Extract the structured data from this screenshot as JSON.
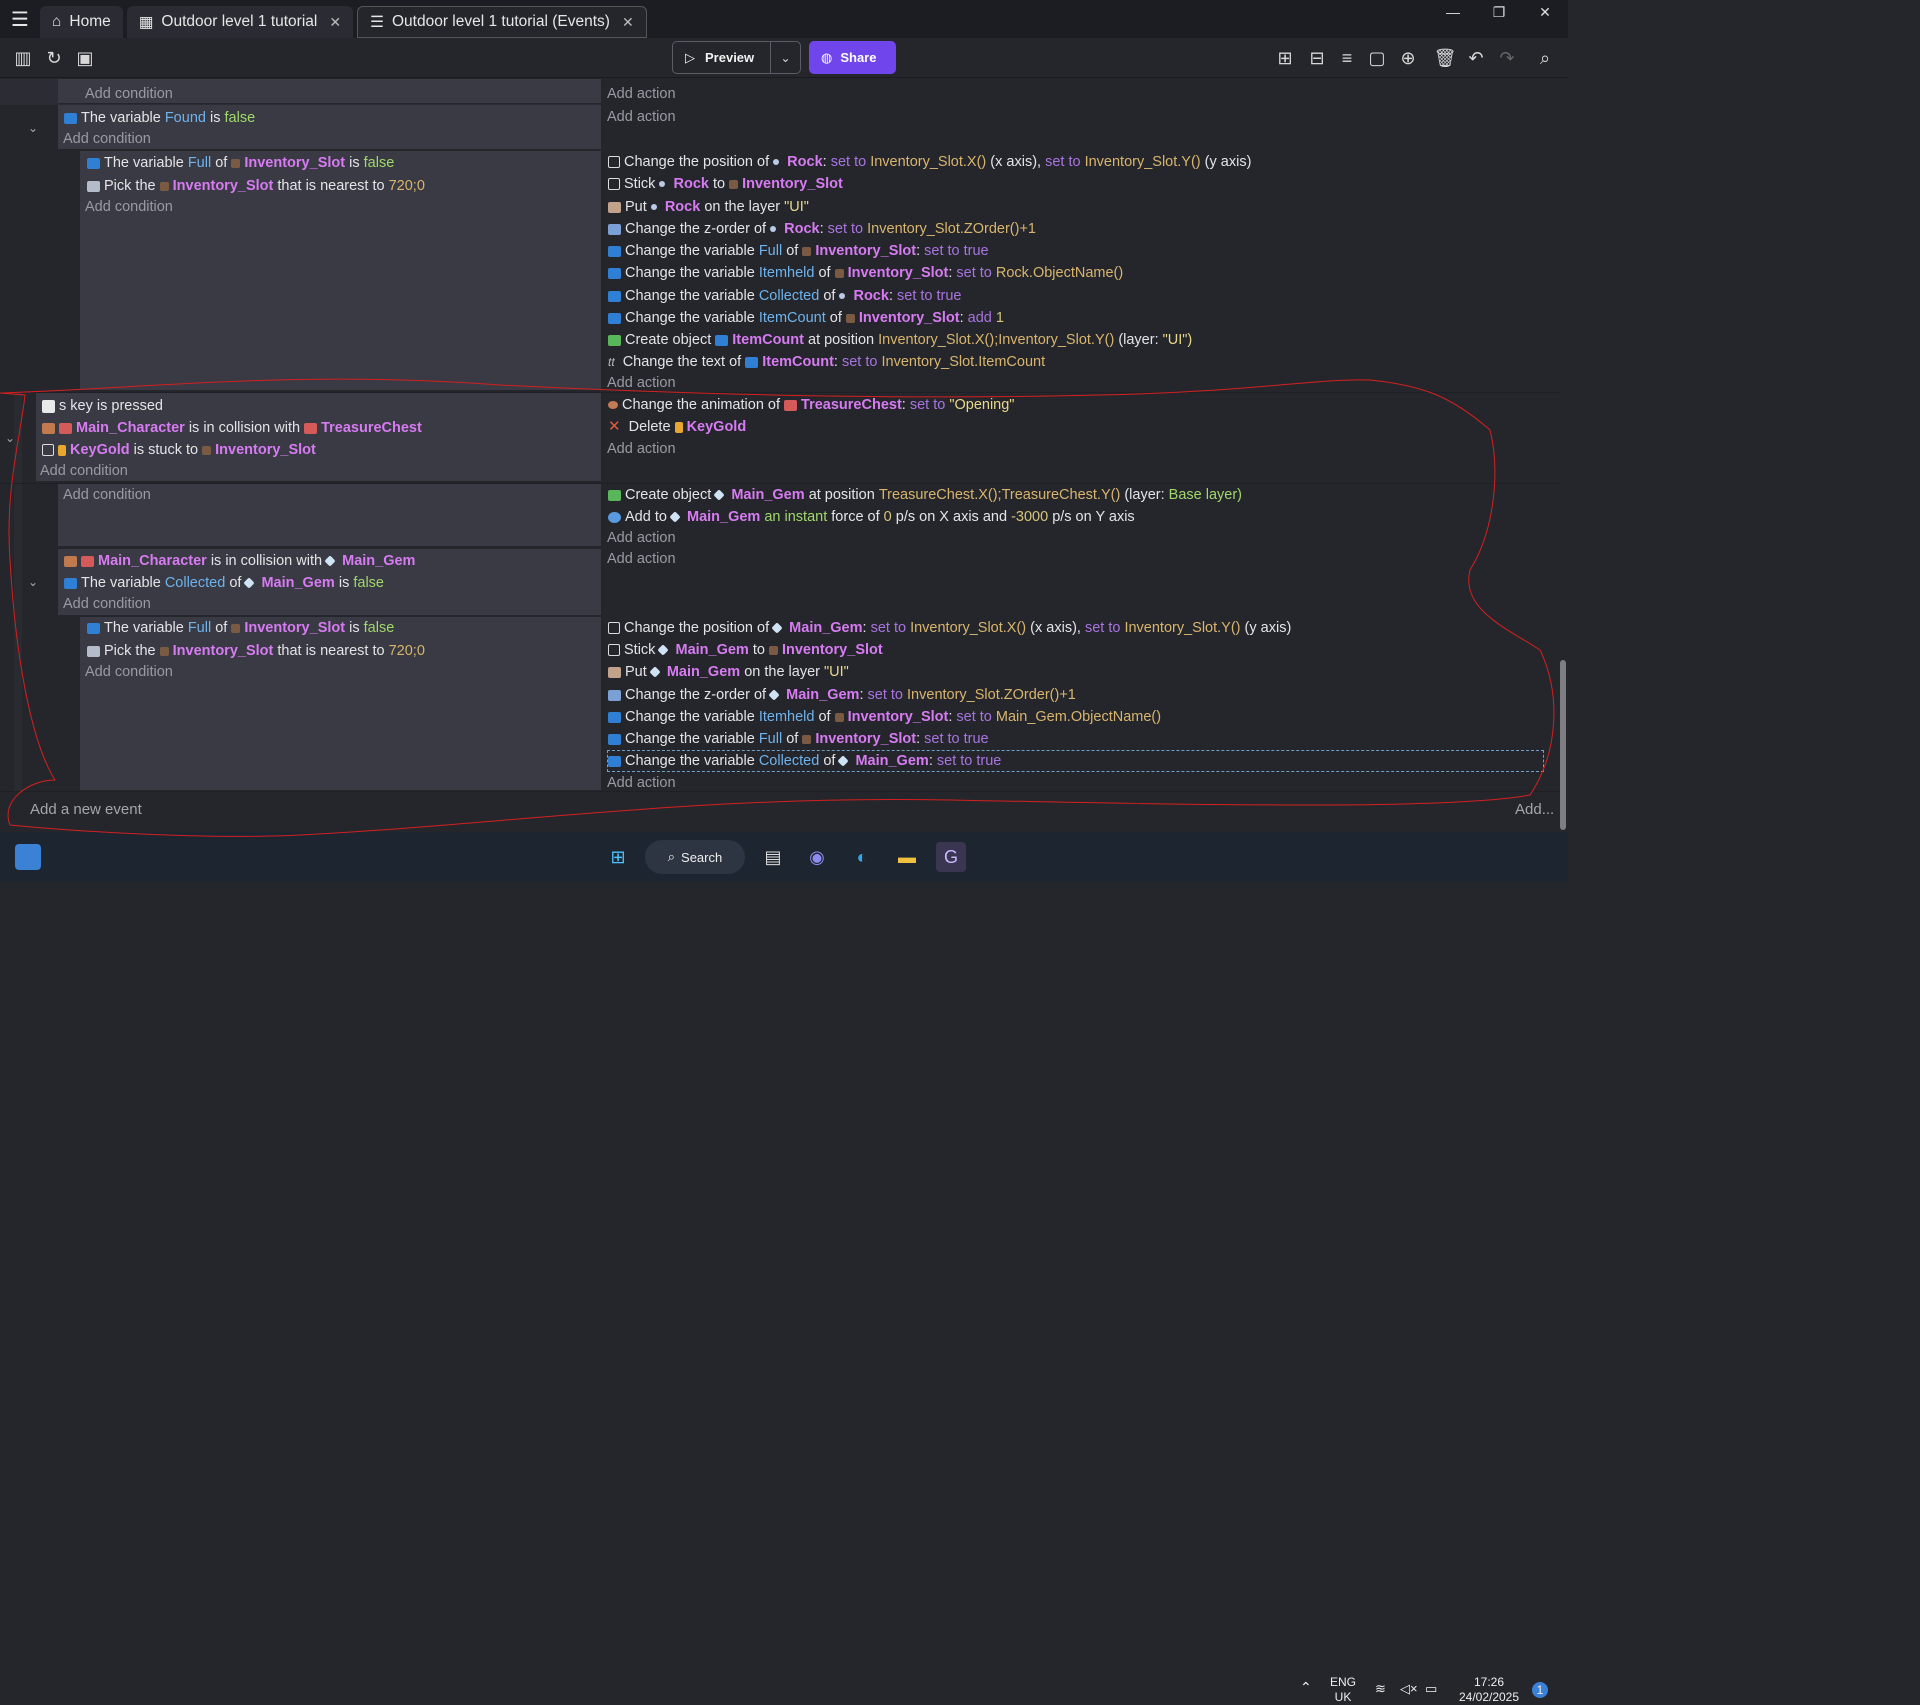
{
  "tabs": [
    {
      "label": "Home",
      "icon": "home-icon"
    },
    {
      "label": "Outdoor level 1 tutorial",
      "icon": "scene-icon"
    },
    {
      "label": "Outdoor level 1 tutorial (Events)",
      "icon": "events-icon"
    }
  ],
  "toolbar": {
    "preview": "Preview",
    "share": "Share"
  },
  "add_condition": "Add condition",
  "add_action": "Add action",
  "add_event": "Add a new event",
  "add_more": "Add...",
  "ev1": {
    "c1a": "The variable",
    "c1b": "Found",
    "c1c": "is",
    "c1d": "false"
  },
  "ev2": {
    "c1a": "The variable",
    "c1b": "Full",
    "c1c": "of",
    "c1d": "Inventory_Slot",
    "c1e": "is",
    "c1f": "false",
    "c2a": "Pick the",
    "c2b": "Inventory_Slot",
    "c2c": "that is nearest to",
    "c2d": "720;0",
    "a1": "Change the position of",
    "a1b": "Rock",
    "a1c": "set to",
    "a1d": "Inventory_Slot.X()",
    "a1e": "(x axis),",
    "a1f": "set to",
    "a1g": "Inventory_Slot.Y()",
    "a1h": "(y axis)",
    "a2": "Stick",
    "a2b": "Rock",
    "a2c": "to",
    "a2d": "Inventory_Slot",
    "a3": "Put",
    "a3b": "Rock",
    "a3c": "on the layer",
    "a3d": "\"UI\"",
    "a4": "Change the z-order of",
    "a4b": "Rock",
    "a4c": "set to",
    "a4d": "Inventory_Slot.ZOrder()+1",
    "a5": "Change the variable",
    "a5b": "Full",
    "a5c": "of",
    "a5d": "Inventory_Slot",
    "a5e": "set to true",
    "a6": "Change the variable",
    "a6b": "Itemheld",
    "a6c": "of",
    "a6d": "Inventory_Slot",
    "a6e": "set to",
    "a6f": "Rock.ObjectName()",
    "a7": "Change the variable",
    "a7b": "Collected",
    "a7c": "of",
    "a7d": "Rock",
    "a7e": "set to true",
    "a8": "Change the variable",
    "a8b": "ItemCount",
    "a8c": "of",
    "a8d": "Inventory_Slot",
    "a8e": "add",
    "a8f": "1",
    "a9": "Create object",
    "a9b": "ItemCount",
    "a9c": "at position",
    "a9d": "Inventory_Slot.X();Inventory_Slot.Y()",
    "a9e": "(layer:",
    "a9f": "\"UI\")",
    "a10": "Change the text of",
    "a10b": "ItemCount",
    "a10c": "set to",
    "a10d": "Inventory_Slot.ItemCount"
  },
  "ev3": {
    "c1a": "s",
    "c1b": "key is pressed",
    "c2a": "Main_Character",
    "c2b": "is in collision with",
    "c2c": "TreasureChest",
    "c3a": "KeyGold",
    "c3b": "is stuck to",
    "c3c": "Inventory_Slot",
    "a1": "Change the animation of",
    "a1b": "TreasureChest",
    "a1c": "set to",
    "a1d": "\"Opening\"",
    "a2": "Delete",
    "a2b": "KeyGold"
  },
  "ev4": {
    "a1": "Create object",
    "a1b": "Main_Gem",
    "a1c": "at position",
    "a1d": "TreasureChest.X();TreasureChest.Y()",
    "a1e": "(layer:",
    "a1f": "Base layer)",
    "a2": "Add to",
    "a2b": "Main_Gem",
    "a2c": "an instant",
    "a2d": "force of",
    "a2e": "0",
    "a2f": "p/s on X axis and",
    "a2g": "-3000",
    "a2h": "p/s on Y axis"
  },
  "ev5": {
    "c1a": "Main_Character",
    "c1b": "is in collision with",
    "c1c": "Main_Gem",
    "c2a": "The variable",
    "c2b": "Collected",
    "c2c": "of",
    "c2d": "Main_Gem",
    "c2e": "is",
    "c2f": "false"
  },
  "ev6": {
    "c1a": "The variable",
    "c1b": "Full",
    "c1c": "of",
    "c1d": "Inventory_Slot",
    "c1e": "is",
    "c1f": "false",
    "c2a": "Pick the",
    "c2b": "Inventory_Slot",
    "c2c": "that is nearest to",
    "c2d": "720;0",
    "a1": "Change the position of",
    "a1b": "Main_Gem",
    "a1c": "set to",
    "a1d": "Inventory_Slot.X()",
    "a1e": "(x axis),",
    "a1f": "set to",
    "a1g": "Inventory_Slot.Y()",
    "a1h": "(y axis)",
    "a2": "Stick",
    "a2b": "Main_Gem",
    "a2c": "to",
    "a2d": "Inventory_Slot",
    "a3": "Put",
    "a3b": "Main_Gem",
    "a3c": "on the layer",
    "a3d": "\"UI\"",
    "a4": "Change the z-order of",
    "a4b": "Main_Gem",
    "a4c": "set to",
    "a4d": "Inventory_Slot.ZOrder()+1",
    "a5": "Change the variable",
    "a5b": "Itemheld",
    "a5c": "of",
    "a5d": "Inventory_Slot",
    "a5e": "set to",
    "a5f": "Main_Gem.ObjectName()",
    "a6": "Change the variable",
    "a6b": "Full",
    "a6c": "of",
    "a6d": "Inventory_Slot",
    "a6e": "set to true",
    "a7": "Change the variable",
    "a7b": "Collected",
    "a7c": "of",
    "a7d": "Main_Gem",
    "a7e": "set to true"
  },
  "taskbar": {
    "search": "Search",
    "lang": "ENG",
    "region": "UK",
    "time": "17:26",
    "date": "24/02/2025",
    "badge": "1"
  },
  "colors": {
    "annotation": "#d02020",
    "accent": "#7046ec"
  }
}
